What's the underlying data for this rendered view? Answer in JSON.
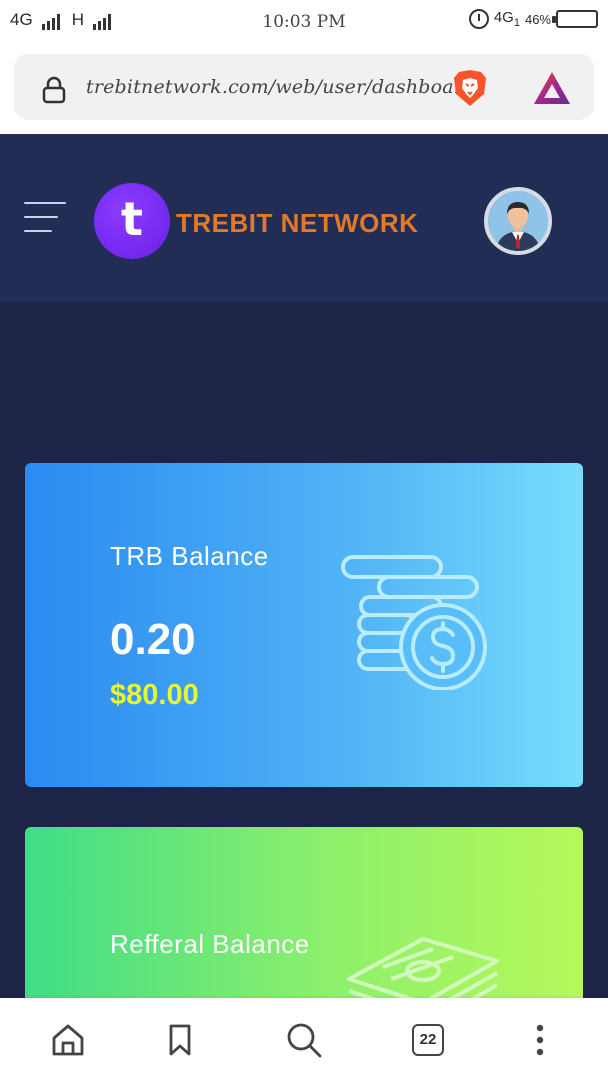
{
  "status_bar": {
    "network_1": "4G",
    "network_2": "H",
    "time": "10:03 PM",
    "network_3": "4G",
    "network_3_sub": "1",
    "battery": "46%"
  },
  "browser": {
    "url": "trebitnetwork.com/web/user/dashboard",
    "open_tabs": "22"
  },
  "header": {
    "logo_letter": "t",
    "brand_name": "TREBIT NETWORK",
    "brand_color": "#e07a28",
    "logo_color": "#7a2ef0"
  },
  "cards": {
    "trb": {
      "title": "TRB Balance",
      "amount": "0.20",
      "usd_value": "$80.00",
      "icon": "coins-dollar-icon"
    },
    "referral": {
      "title": "Refferal Balance",
      "icon": "cash-stack-icon"
    }
  },
  "bottom_nav": {
    "items": [
      "home-icon",
      "bookmark-icon",
      "search-icon",
      "tabs-icon",
      "more-icon"
    ]
  }
}
